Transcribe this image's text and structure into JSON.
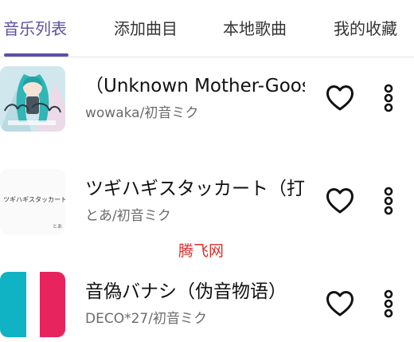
{
  "colors": {
    "accent": "#5f4fa6",
    "divider": "#e4e4e4",
    "title_text": "#111111",
    "artist_text": "#6b6b6b",
    "watermark": "#d9302c",
    "cover3_left": "#10b3c4",
    "cover3_right": "#e8245e"
  },
  "tabs": [
    {
      "label": "音乐列表",
      "active": true
    },
    {
      "label": "添加曲目",
      "active": false
    },
    {
      "label": "本地歌曲",
      "active": false
    },
    {
      "label": "我的收藏",
      "active": false
    }
  ],
  "songs": [
    {
      "title": "（Unknown Mother-Goose）",
      "artist": "wowaka/初音ミク",
      "cover_icon": "album-art-restart",
      "fav_icon": "heart-outline-icon",
      "more_icon": "more-vertical-icon"
    },
    {
      "title": "ツギハギスタッカート（打",
      "artist": "とあ/初音ミク",
      "cover_icon": "album-art-tsugihagi",
      "cover_text": "ツギハギスタッカート",
      "cover_subtext": "とあ",
      "fav_icon": "heart-outline-icon",
      "more_icon": "more-vertical-icon"
    },
    {
      "title": "音偽バナシ（伪音物语）",
      "artist": "DECO*27/初音ミク",
      "cover_icon": "album-art-otogibanashi",
      "fav_icon": "heart-outline-icon",
      "more_icon": "more-vertical-icon"
    }
  ],
  "watermark": "腾飞网"
}
